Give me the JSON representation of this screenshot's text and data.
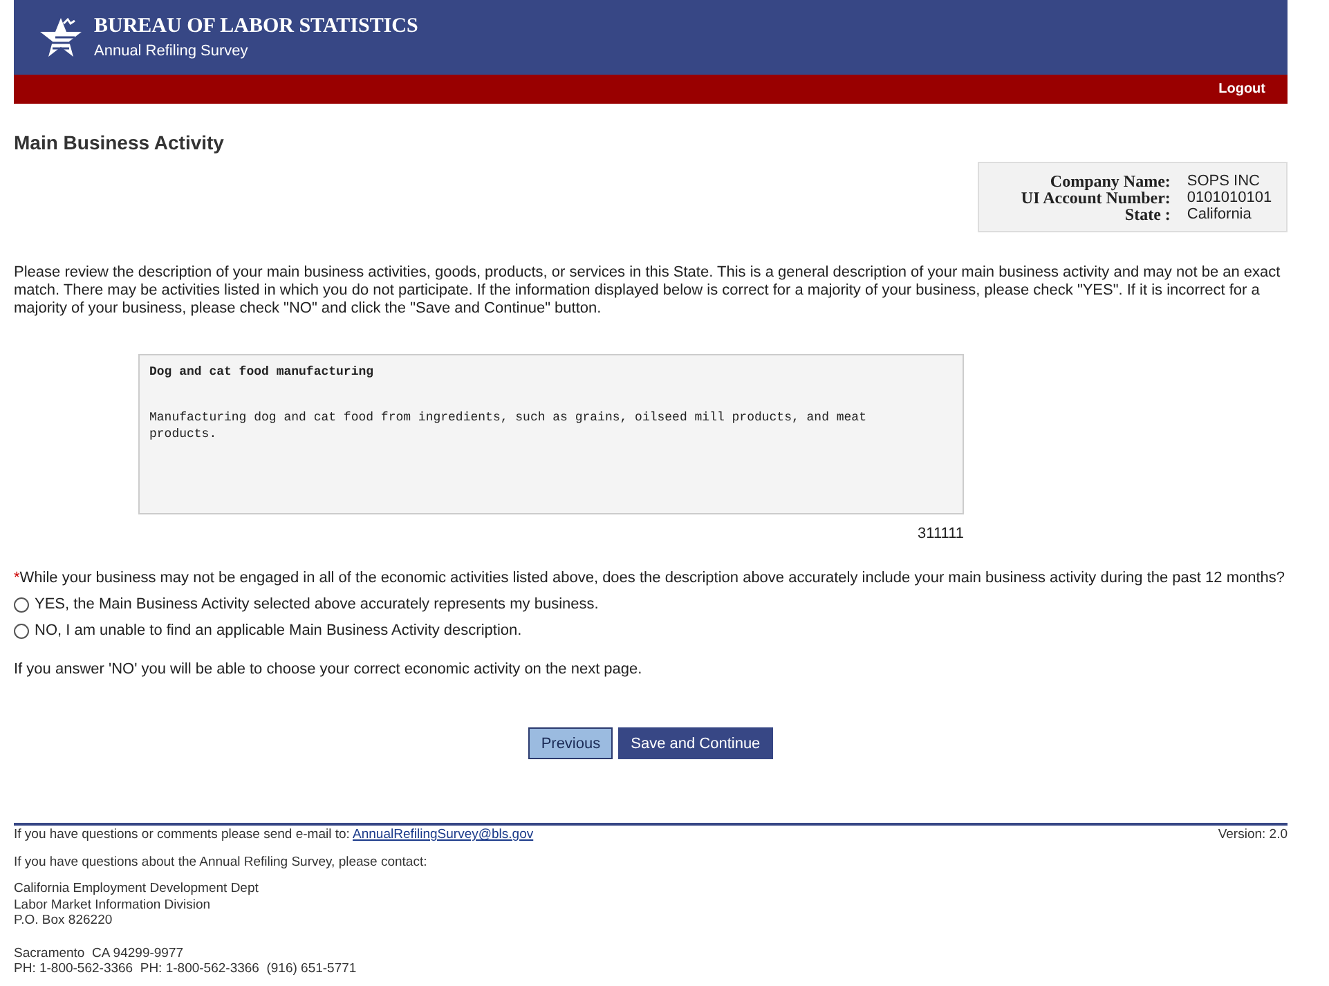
{
  "header": {
    "title": "BUREAU OF LABOR STATISTICS",
    "subtitle": "Annual Refiling Survey",
    "logout": "Logout"
  },
  "page_title": "Main Business Activity",
  "company_info": [
    {
      "label": "Company Name:",
      "value": "SOPS INC"
    },
    {
      "label": "UI Account Number:",
      "value": "0101010101"
    },
    {
      "label": "State :",
      "value": "California"
    }
  ],
  "intro": "Please review the description of your main business activities, goods, products, or services in this State. This is a general description of your main business activity and may not be an exact match. There may be activities listed in which you do not participate. If the information displayed below is correct for a majority of your business, please check \"YES\". If it is incorrect for a majority of your business, please check \"NO\" and click the \"Save and Continue\" button.",
  "activity": {
    "title": "Dog and cat food manufacturing",
    "description": "Manufacturing dog and cat food from ingredients, such as grains, oilseed mill products, and meat products.",
    "code": "311111"
  },
  "question": {
    "required_mark": "*",
    "text": "While your business may not be engaged in all of the economic activities listed above, does the description above accurately include your main business activity during the past 12 months?"
  },
  "options": [
    {
      "label": "YES, the Main Business Activity selected above accurately represents my business.",
      "selected": false
    },
    {
      "label": "NO, I am unable to find an applicable Main Business Activity description.",
      "selected": false
    }
  ],
  "note": "If you answer 'NO' you will be able to choose your correct economic activity on the next page.",
  "buttons": [
    {
      "label": "Previous",
      "kind": "secondary"
    },
    {
      "label": "Save and Continue",
      "kind": "primary"
    }
  ],
  "footer": {
    "email_text": "If you have questions or comments please send e-mail to:",
    "email": "AnnualRefilingSurvey@bls.gov",
    "version": "Version: 2.0",
    "contact_text": "If you have questions about the Annual Refiling Survey, please contact:",
    "address": [
      "California Employment Development Dept",
      "Labor Market Information Division",
      "P.O. Box 826220"
    ],
    "city_lines": [
      "Sacramento  CA 94299-9977",
      "PH: 1-800-562-3366  PH: 1-800-562-3366  (916) 651-5771"
    ]
  }
}
